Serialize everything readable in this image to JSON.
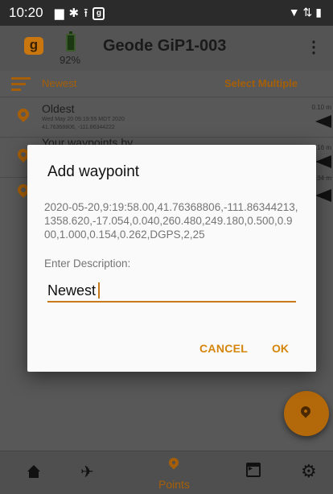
{
  "status_bar": {
    "time": "10:20",
    "left_icons": [
      "image-icon",
      "gear-icon",
      "upload-icon",
      "geode-app-icon"
    ],
    "right_icons": [
      "wifi-icon",
      "data-icon",
      "battery-icon"
    ]
  },
  "app_bar": {
    "logo_text": "g",
    "battery_percent": "92%",
    "title": "Geode GiP1-003",
    "menu_label": "⋮"
  },
  "sort_bar": {
    "sort_label": "Newest",
    "select_multiple_label": "Select Multiple"
  },
  "waypoints": [
    {
      "name": "Oldest",
      "date": "Wed May 20 09:19:55 MDT 2020",
      "coords": "41.76368806, -111.86344222",
      "distance": "0.10 m"
    },
    {
      "name": "Your waypoints by",
      "date": "",
      "coords": "",
      "distance": "0.16 m"
    },
    {
      "name": "",
      "date": "",
      "coords": "",
      "distance": "0.34 m"
    }
  ],
  "dialog": {
    "title": "Add waypoint",
    "body": "2020-05-20,9:19:58.00,41.76368806,-111.86344213,1358.620,-17.054,0.040,260.480,249.180,0.500,0.900,1.000,0.154,0.262,DGPS,2,25",
    "description_label": "Enter Description:",
    "description_value": "Newest",
    "cancel_label": "CANCEL",
    "ok_label": "OK"
  },
  "bottom_nav": {
    "items": [
      {
        "icon": "home-icon",
        "label": ""
      },
      {
        "icon": "satellite-icon",
        "label": ""
      },
      {
        "icon": "points-icon",
        "label": "Points"
      },
      {
        "icon": "console-icon",
        "label": ""
      },
      {
        "icon": "gear-icon",
        "label": ""
      }
    ]
  },
  "colors": {
    "accent": "#d4850a",
    "accent_dim": "#a65f06",
    "app_bar": "#545454",
    "content_bg": "#585858",
    "dialog_bg": "#fafafa"
  }
}
